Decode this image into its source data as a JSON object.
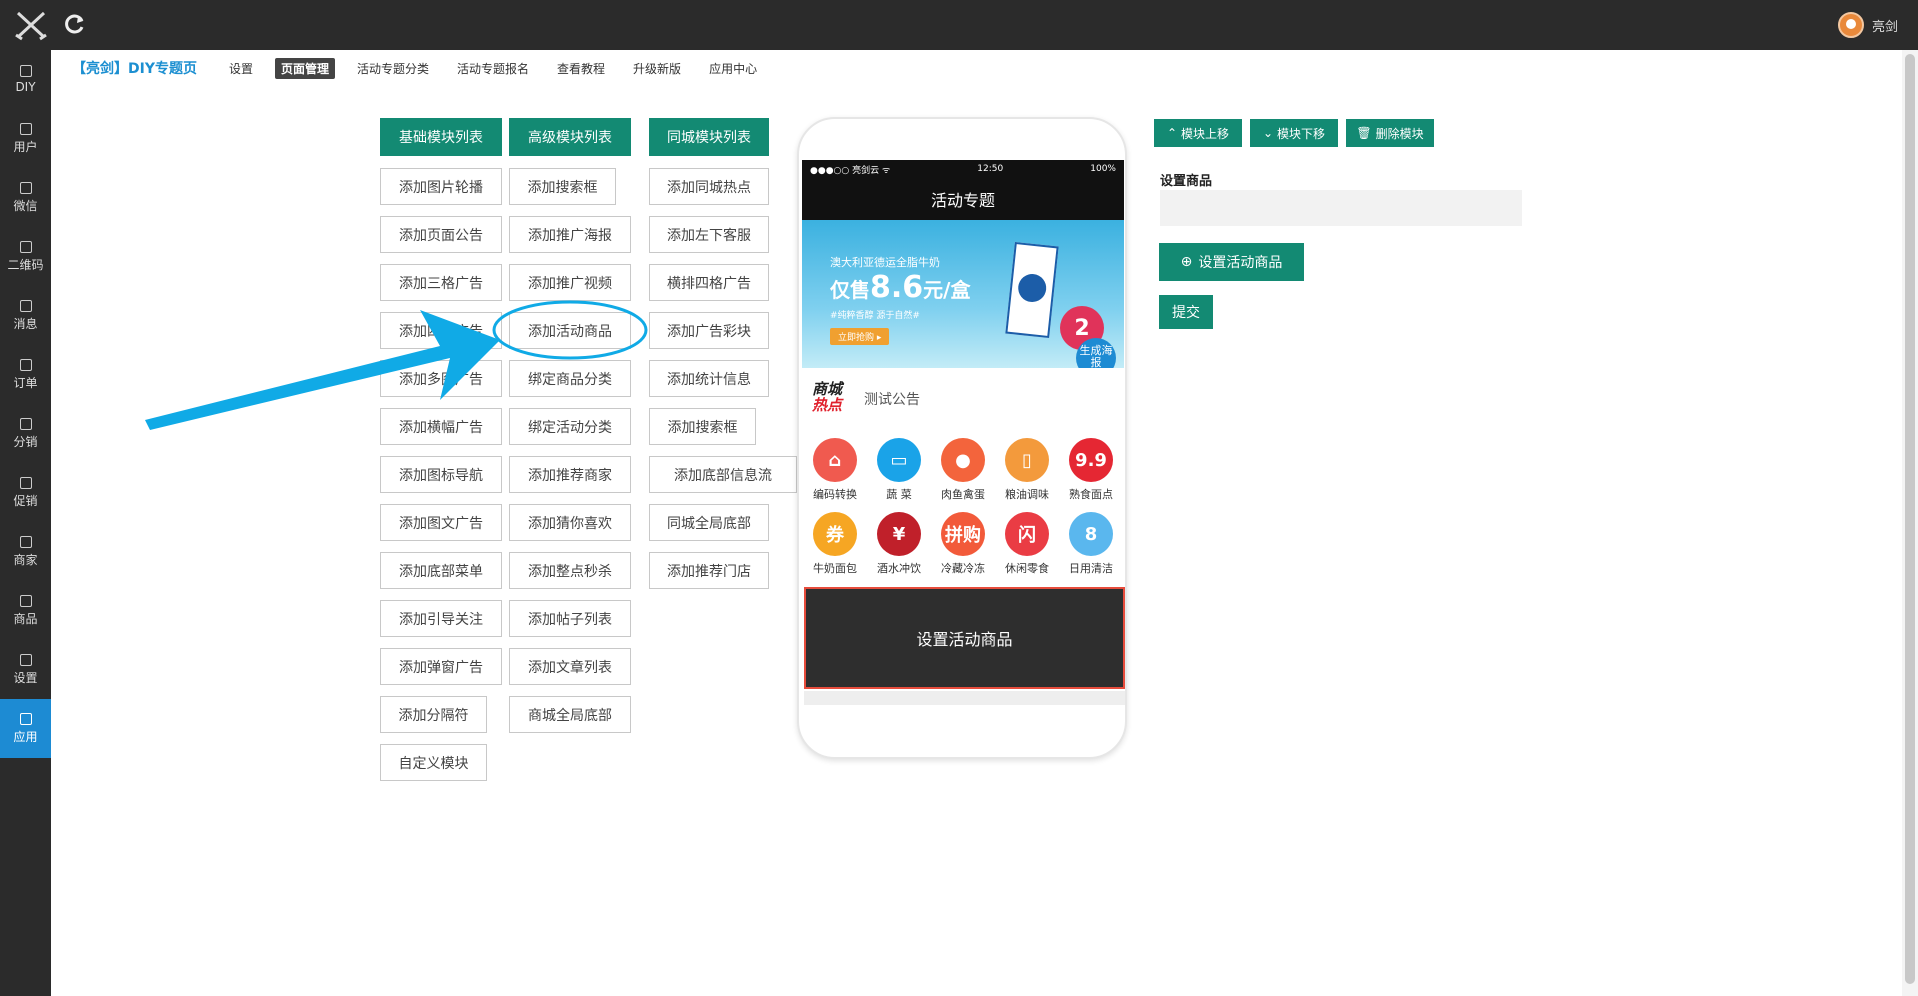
{
  "topbar": {
    "username": "亮剑"
  },
  "sidebar": {
    "items": [
      {
        "label": "DIY",
        "icon": "thumbs-up-icon"
      },
      {
        "label": "用户",
        "icon": "twitter-icon"
      },
      {
        "label": "微信",
        "icon": "wechat-icon"
      },
      {
        "label": "二维码",
        "icon": "qrcode-icon"
      },
      {
        "label": "消息",
        "icon": "message-icon"
      },
      {
        "label": "订单",
        "icon": "document-icon"
      },
      {
        "label": "分销",
        "icon": "document-icon"
      },
      {
        "label": "促销",
        "icon": "document-icon"
      },
      {
        "label": "商家",
        "icon": "document-icon"
      },
      {
        "label": "商品",
        "icon": "document-icon"
      },
      {
        "label": "设置",
        "icon": "document-icon"
      },
      {
        "label": "应用",
        "icon": "download-icon"
      }
    ]
  },
  "subnav": {
    "brand": "【亮剑】DIY专题页",
    "tabs": [
      "设置",
      "页面管理",
      "活动专题分类",
      "活动专题报名",
      "查看教程",
      "升级新版",
      "应用中心"
    ],
    "active": "页面管理"
  },
  "module_headers": [
    "基础模块列表",
    "高级模块列表",
    "同城模块列表"
  ],
  "basic_modules": [
    "添加图片轮播",
    "添加页面公告",
    "添加三格广告",
    "添加四格广告",
    "添加多图广告",
    "添加横幅广告",
    "添加图标导航",
    "添加图文广告",
    "添加底部菜单",
    "添加引导关注",
    "添加弹窗广告",
    "添加分隔符",
    "自定义模块"
  ],
  "advanced_modules": [
    "添加搜索框",
    "添加推广海报",
    "添加推广视频",
    "添加活动商品",
    "绑定商品分类",
    "绑定活动分类",
    "添加推荐商家",
    "添加猜你喜欢",
    "添加整点秒杀",
    "添加帖子列表",
    "添加文章列表",
    "商城全局底部"
  ],
  "city_modules": [
    "添加同城热点",
    "添加左下客服",
    "横排四格广告",
    "添加广告彩块",
    "添加统计信息",
    "添加搜索框",
    "添加底部信息流",
    "同城全局底部",
    "添加推荐门店"
  ],
  "phone": {
    "status_left": "●●●○○ 亮剑云 ᯤ",
    "status_time": "12:50",
    "status_battery": "100%",
    "title": "活动专题",
    "banner": {
      "line1": "澳大利亚德运全脂牛奶",
      "line2_prefix": "仅售",
      "line2_price": "8.6",
      "line2_suffix": "元/盒",
      "line3": "#纯粹香醇 源于自然#",
      "button": "立即抢购 ▸",
      "badge": "2",
      "poster": "生成海报"
    },
    "notice_tag_top": "商城",
    "notice_tag_bottom": "热点",
    "notice_text": "测试公告",
    "nav_icons": [
      {
        "label": "编码转换",
        "color": "#f05a4f",
        "glyph": "⌂"
      },
      {
        "label": "蔬 菜",
        "color": "#1aa3e8",
        "glyph": "▭"
      },
      {
        "label": "肉鱼禽蛋",
        "color": "#f3643c",
        "glyph": "●"
      },
      {
        "label": "粮油调味",
        "color": "#f39a3c",
        "glyph": "▯"
      },
      {
        "label": "熟食面点",
        "color": "#e52733",
        "glyph": "9.9"
      },
      {
        "label": "牛奶面包",
        "color": "#f6a623",
        "glyph": "券"
      },
      {
        "label": "酒水冲饮",
        "color": "#c0202a",
        "glyph": "¥"
      },
      {
        "label": "冷藏冷冻",
        "color": "#f25a3a",
        "glyph": "拼购"
      },
      {
        "label": "休闲零食",
        "color": "#ea3c44",
        "glyph": "闪"
      },
      {
        "label": "日用清洁",
        "color": "#5ab7ee",
        "glyph": "8"
      }
    ],
    "goods_box": "设置活动商品"
  },
  "right_panel": {
    "move_up": "模块上移",
    "move_down": "模块下移",
    "delete": "删除模块",
    "field_label": "设置商品",
    "set_goods_button": "设置活动商品",
    "submit": "提交"
  },
  "colors": {
    "primary_green": "#138a73",
    "sidebar_bg": "#2b2b2b",
    "active_blue": "#1d8bd3",
    "annotation": "#10aae6"
  }
}
